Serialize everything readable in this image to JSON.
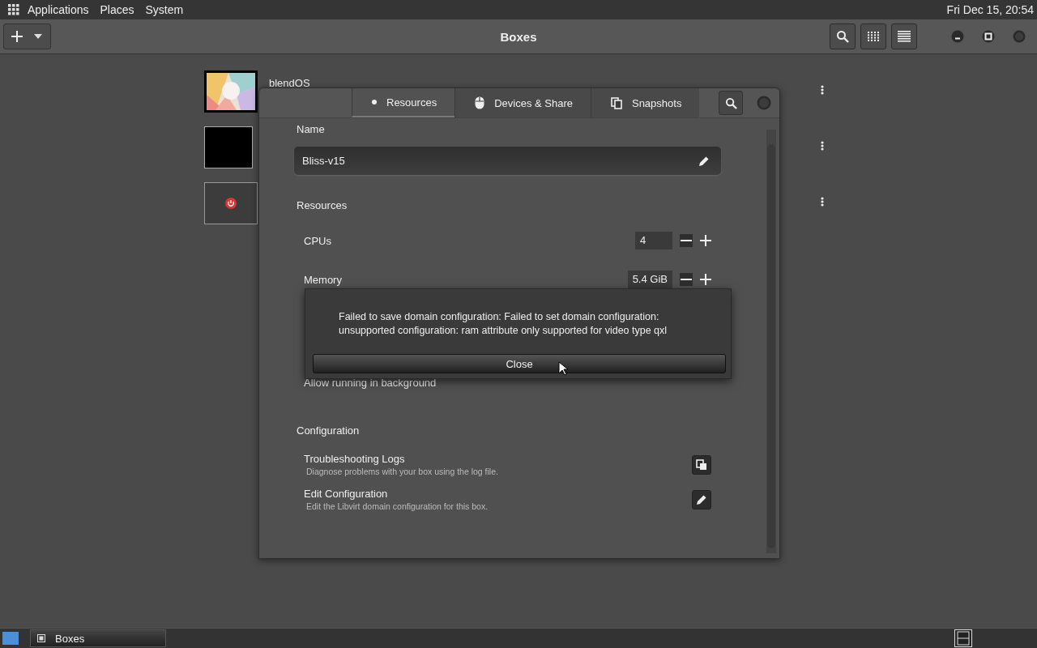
{
  "top_panel": {
    "menus": [
      "Applications",
      "Places",
      "System"
    ],
    "clock": "Fri Dec 15, 20:54"
  },
  "header": {
    "title": "Boxes"
  },
  "boxes": [
    {
      "name": "blendOS",
      "kind": "picture"
    },
    {
      "kind": "blank"
    },
    {
      "kind": "off"
    }
  ],
  "properties": {
    "tabs": [
      {
        "label": "Resources",
        "selected": true
      },
      {
        "label": "Devices & Share",
        "selected": false
      },
      {
        "label": "Snapshots",
        "selected": false
      }
    ],
    "name_label": "Name",
    "name_value": "Bliss-v15",
    "resources_heading": "Resources",
    "rows": [
      {
        "label": "CPUs",
        "value": "4"
      },
      {
        "label": "Memory",
        "value": "5.4 GiB"
      },
      {
        "label": "Allow running in background"
      }
    ],
    "configuration_heading": "Configuration",
    "config_items": [
      {
        "title": "Troubleshooting Logs",
        "description": "Diagnose problems with your box using the log file."
      },
      {
        "title": "Edit Configuration",
        "description": "Edit the Libvirt domain configuration for this box."
      }
    ]
  },
  "error_dialog": {
    "message": "Failed to save domain configuration: Failed to set domain configuration: unsupported configuration: ram attribute only supported for video type qxl",
    "button": "Close"
  },
  "taskbar": {
    "tasks": [
      {
        "label": "Boxes"
      }
    ]
  }
}
